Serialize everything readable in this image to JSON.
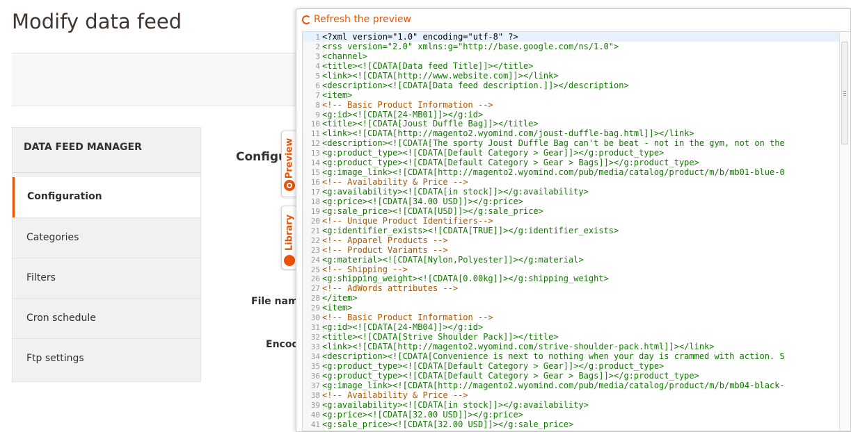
{
  "page": {
    "title": "Modify data feed"
  },
  "side_menu": {
    "title": "DATA FEED MANAGER",
    "items": [
      {
        "label": "Configuration",
        "active": true
      },
      {
        "label": "Categories",
        "active": false
      },
      {
        "label": "Filters",
        "active": false
      },
      {
        "label": "Cron schedule",
        "active": false
      },
      {
        "label": "Ftp settings",
        "active": false
      }
    ]
  },
  "main": {
    "section_title": "Configur",
    "fields": {
      "file_name_label": "File name",
      "encoding_label": "Encodi"
    }
  },
  "tabs": {
    "preview": "Preview",
    "library": "Library"
  },
  "preview": {
    "refresh_label": "Refresh the preview",
    "accent_color": "#eb5202",
    "lines": [
      {
        "n": "1",
        "t": "<?xml version=\"1.0\" encoding=\"utf-8\" ?>",
        "k": "hl"
      },
      {
        "n": "2",
        "t": "<rss version=\"2.0\" xmlns:g=\"http://base.google.com/ns/1.0\">",
        "k": "tag"
      },
      {
        "n": "3",
        "t": "<channel>",
        "k": "tag"
      },
      {
        "n": "4",
        "t": "<title><![CDATA[Data feed Title]]></title>",
        "k": "tag"
      },
      {
        "n": "5",
        "t": "<link><![CDATA[http://www.website.com]]></link>",
        "k": "tag"
      },
      {
        "n": "6",
        "t": "<description><![CDATA[Data feed description.]]></description>",
        "k": "tag"
      },
      {
        "n": "7",
        "t": "<item>",
        "k": "tag"
      },
      {
        "n": "8",
        "t": "<!-- Basic Product Information -->",
        "k": "cmt"
      },
      {
        "n": "9",
        "t": "<g:id><![CDATA[24-MB01]]></g:id>",
        "k": "tag"
      },
      {
        "n": "10",
        "t": "<title><![CDATA[Joust Duffle Bag]]></title>",
        "k": "tag"
      },
      {
        "n": "11",
        "t": "<link><![CDATA[http://magento2.wyomind.com/joust-duffle-bag.html]]></link>",
        "k": "tag"
      },
      {
        "n": "12",
        "t": "<description><![CDATA[The sporty Joust Duffle Bag can't be beat - not in the gym, not on the",
        "k": "tag"
      },
      {
        "n": "13",
        "t": "<g:product_type><![CDATA[Default Category > Gear]]></g:product_type>",
        "k": "tag"
      },
      {
        "n": "14",
        "t": "<g:product_type><![CDATA[Default Category > Gear > Bags]]></g:product_type>",
        "k": "tag"
      },
      {
        "n": "15",
        "t": "<g:image_link><![CDATA[http://magento2.wyomind.com/pub/media/catalog/product/m/b/mb01-blue-0",
        "k": "tag"
      },
      {
        "n": "16",
        "t": "<!-- Availability & Price -->",
        "k": "cmt"
      },
      {
        "n": "17",
        "t": "<g:availability><![CDATA[in stock]]></g:availability>",
        "k": "tag"
      },
      {
        "n": "18",
        "t": "<g:price><![CDATA[34.00 USD]]></g:price>",
        "k": "tag"
      },
      {
        "n": "19",
        "t": "<g:sale_price><![CDATA[USD]]></g:sale_price>",
        "k": "tag"
      },
      {
        "n": "20",
        "t": "<!-- Unique Product Identifiers-->",
        "k": "cmt"
      },
      {
        "n": "21",
        "t": "<g:identifier_exists><![CDATA[TRUE]]></g:identifier_exists>",
        "k": "tag"
      },
      {
        "n": "22",
        "t": "<!-- Apparel Products -->",
        "k": "cmt"
      },
      {
        "n": "23",
        "t": "<!-- Product Variants -->",
        "k": "cmt"
      },
      {
        "n": "24",
        "t": "<g:material><![CDATA[Nylon,Polyester]]></g:material>",
        "k": "tag"
      },
      {
        "n": "25",
        "t": "<!-- Shipping -->",
        "k": "cmt"
      },
      {
        "n": "26",
        "t": "<g:shipping_weight><![CDATA[0.00kg]]></g:shipping_weight>",
        "k": "tag"
      },
      {
        "n": "27",
        "t": "<!-- AdWords attributes -->",
        "k": "cmt"
      },
      {
        "n": "28",
        "t": "</item>",
        "k": "tag"
      },
      {
        "n": "29",
        "t": "<item>",
        "k": "tag"
      },
      {
        "n": "30",
        "t": "<!-- Basic Product Information -->",
        "k": "cmt"
      },
      {
        "n": "31",
        "t": "<g:id><![CDATA[24-MB04]]></g:id>",
        "k": "tag"
      },
      {
        "n": "32",
        "t": "<title><![CDATA[Strive Shoulder Pack]]></title>",
        "k": "tag"
      },
      {
        "n": "33",
        "t": "<link><![CDATA[http://magento2.wyomind.com/strive-shoulder-pack.html]]></link>",
        "k": "tag"
      },
      {
        "n": "34",
        "t": "<description><![CDATA[Convenience is next to nothing when your day is crammed with action. S",
        "k": "tag"
      },
      {
        "n": "35",
        "t": "<g:product_type><![CDATA[Default Category > Gear]]></g:product_type>",
        "k": "tag"
      },
      {
        "n": "36",
        "t": "<g:product_type><![CDATA[Default Category > Gear > Bags]]></g:product_type>",
        "k": "tag"
      },
      {
        "n": "37",
        "t": "<g:image_link><![CDATA[http://magento2.wyomind.com/pub/media/catalog/product/m/b/mb04-black-",
        "k": "tag"
      },
      {
        "n": "38",
        "t": "<!-- Availability & Price -->",
        "k": "cmt"
      },
      {
        "n": "39",
        "t": "<g:availability><![CDATA[in stock]]></g:availability>",
        "k": "tag"
      },
      {
        "n": "40",
        "t": "<g:price><![CDATA[32.00 USD]]></g:price>",
        "k": "tag"
      },
      {
        "n": "41",
        "t": "<g:sale_price><![CDATA[32.00 USD]]></g:sale_price>",
        "k": "tag"
      }
    ]
  }
}
